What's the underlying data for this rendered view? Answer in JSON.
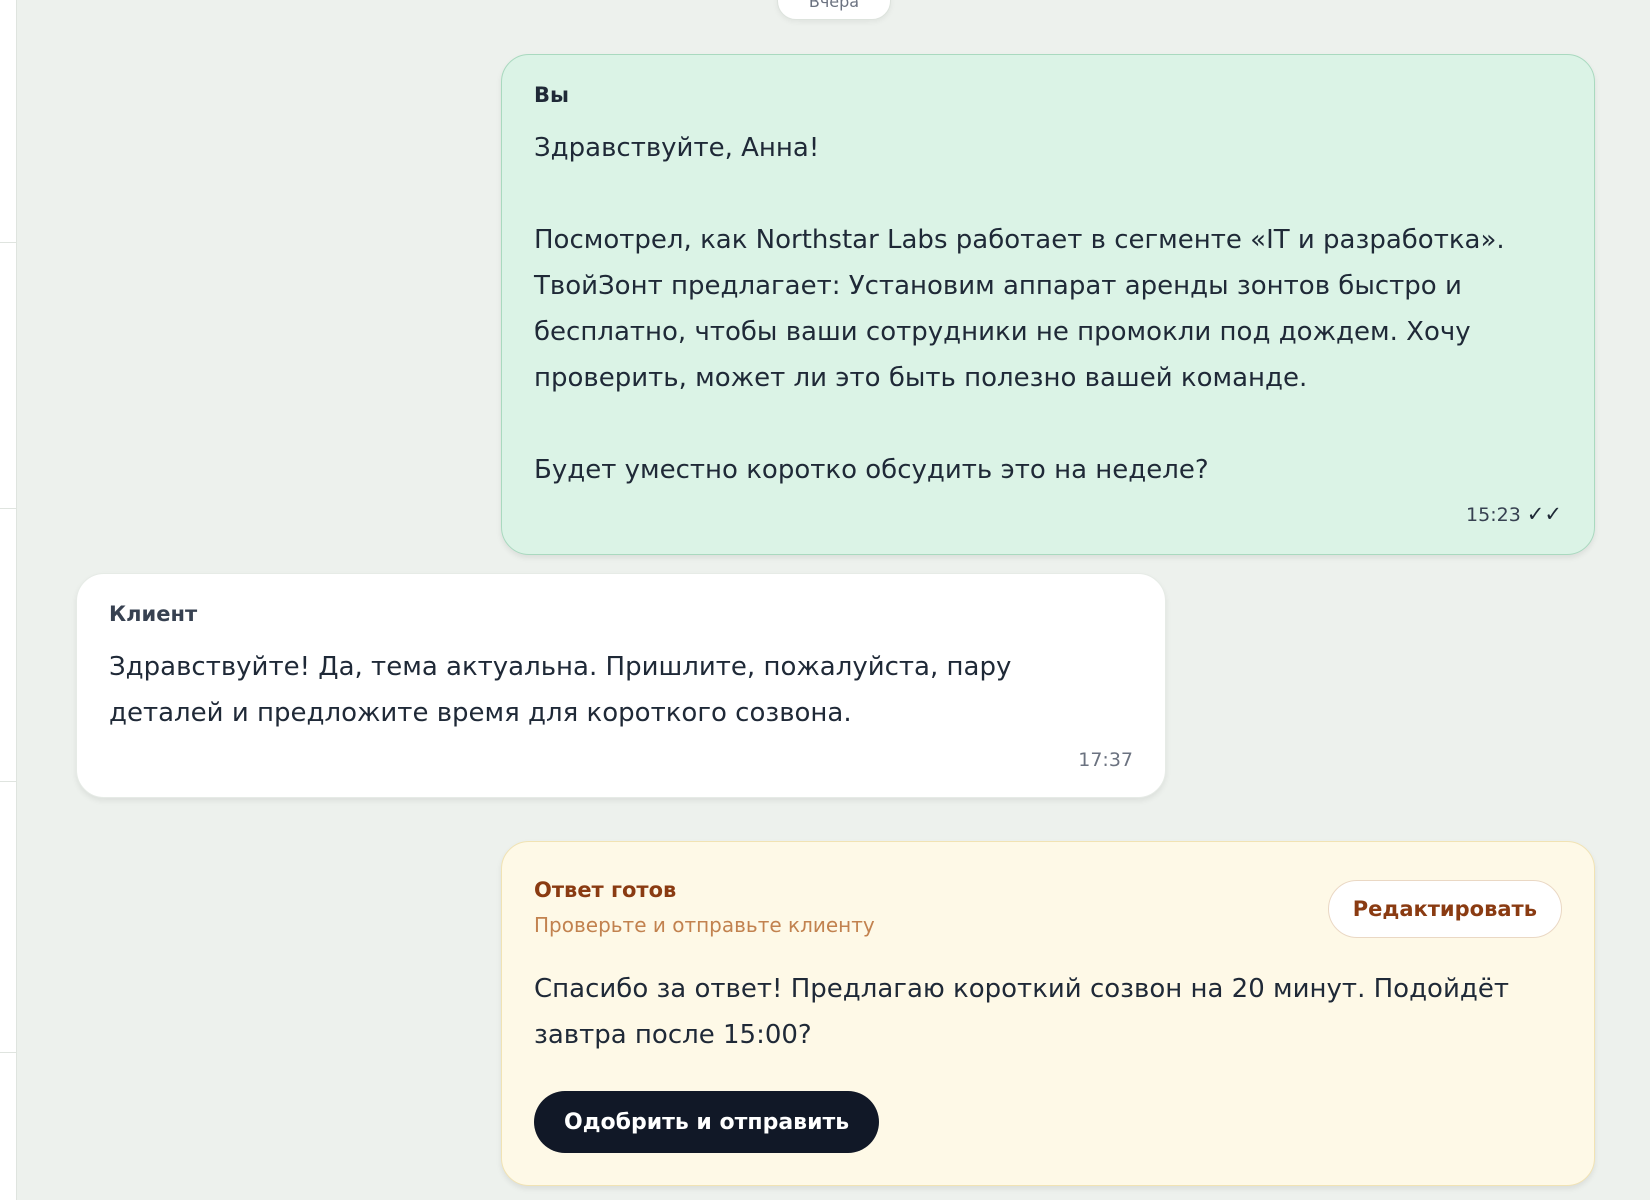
{
  "date_separator": "Вчера",
  "messages": {
    "outgoing": {
      "sender": "Вы",
      "text": "Здравствуйте, Анна!\n\nПосмотрел, как Northstar Labs работает в сегменте «IT и разработка». ТвойЗонт предлагает: Установим аппарат аренды зонтов быстро и бесплатно, чтобы ваши сотрудники не промокли под дождем. Хочу проверить, может ли это быть полезно вашей команде.\n\nБудет уместно коротко обсудить это на неделе?",
      "time": "15:23",
      "status_icon": "double-check-icon",
      "status_glyph": "✓✓"
    },
    "incoming": {
      "sender": "Клиент",
      "text": "Здравствуйте! Да, тема актуальна. Пришлите, пожалуйста, пару деталей и предложите время для короткого созвона.",
      "time": "17:37"
    }
  },
  "draft": {
    "title": "Ответ готов",
    "subtitle": "Проверьте и отправьте клиенту",
    "text": "Спасибо за ответ! Предлагаю короткий созвон на 20 минут. Подойдёт завтра после 15:00?",
    "edit_label": "Редактировать",
    "approve_label": "Одобрить и отправить"
  }
}
